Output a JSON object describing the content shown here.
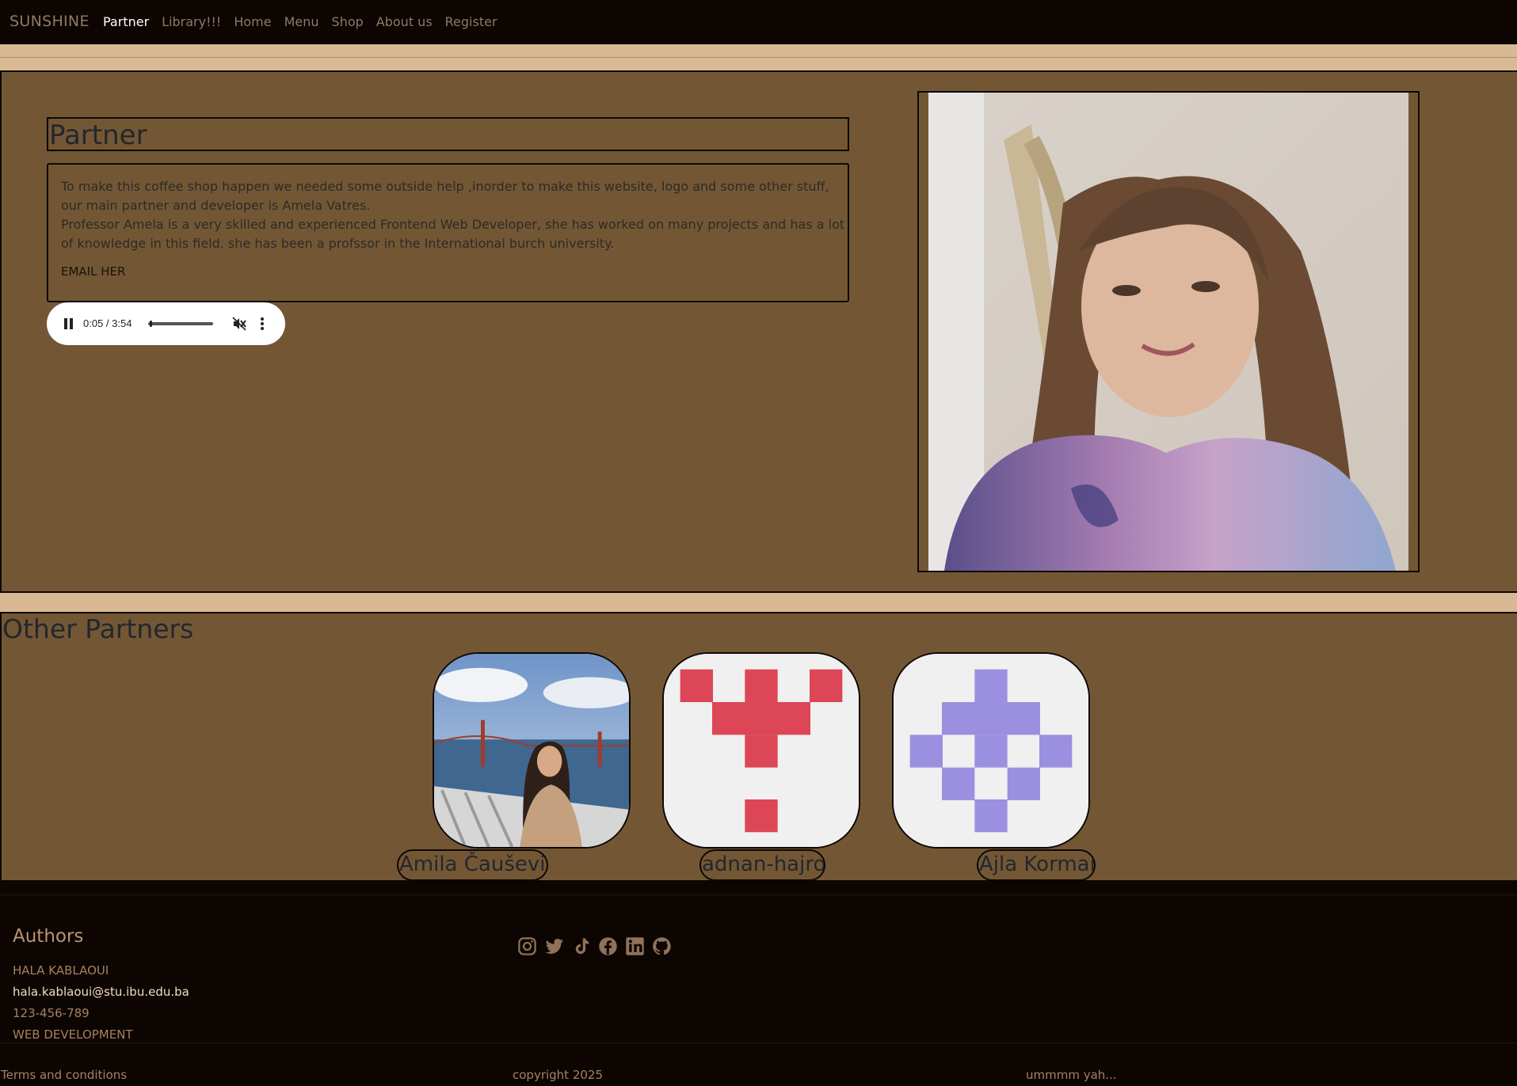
{
  "nav": {
    "brand": "SUNSHINE",
    "links": [
      "Partner",
      "Library!!!",
      "Home",
      "Menu",
      "Shop",
      "About us",
      "Register"
    ],
    "active": "Partner"
  },
  "partner": {
    "title": "Partner",
    "description_1": "To make this coffee shop happen we needed some outside help ,inorder to make this website, logo and some other stuff, our main partner and developer is Amela Vatres.",
    "description_2": "Professor Amela is a very skilled and experienced Frontend Web Developer, she has worked on many projects and has a lot of knowledge in this field. she has been a profssor in the International burch university.",
    "email_label": "EMAIL HER",
    "audio": {
      "time": "0:05 / 3:54",
      "progress": 0.02,
      "muted": true
    }
  },
  "others": {
    "title": "Other Partners",
    "partners": [
      {
        "name": "Amila Čaušević",
        "avatar": "photo"
      },
      {
        "name": "adnan-hajro",
        "avatar": "identicon-red"
      },
      {
        "name": "Ajla Korman",
        "avatar": "identicon-purple"
      }
    ]
  },
  "footer": {
    "authors_title": "Authors",
    "author_name": "HALA KABLAOUI",
    "author_email": "hala.kablaoui@stu.ibu.edu.ba",
    "author_phone": "123-456-789",
    "author_course": "WEB DEVELOPMENT",
    "socials": [
      "instagram-icon",
      "twitter-icon",
      "tiktok-icon",
      "facebook-icon",
      "linkedin-icon",
      "github-icon"
    ],
    "terms": "Terms and conditions",
    "copyright": "copyright 2025",
    "tagline": "ummmm yah..."
  },
  "colors": {
    "nav_bg": "#0c0502",
    "page_bg": "#d9b993",
    "section_bg": "#735735",
    "identicon_red": "#dc4656",
    "identicon_purple": "#9b8fe0"
  }
}
